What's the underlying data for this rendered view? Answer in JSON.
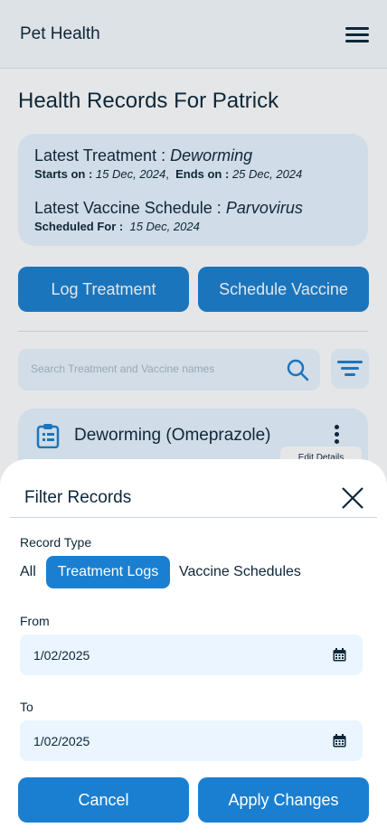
{
  "app": {
    "title": "Pet Health"
  },
  "page": {
    "title": "Health Records For Patrick"
  },
  "summary": {
    "treatment_label": "Latest Treatment : ",
    "treatment_name": "Deworming",
    "starts_label": "Starts on : ",
    "starts_date": "15 Dec, 2024",
    "ends_label": "Ends on : ",
    "ends_date": "25 Dec, 2024",
    "vaccine_label": "Latest Vaccine Schedule : ",
    "vaccine_name": "Parvovirus",
    "scheduled_label": "Scheduled For : ",
    "scheduled_date": "15 Dec, 2024"
  },
  "actions": {
    "log_treatment": "Log Treatment",
    "schedule_vaccine": "Schedule Vaccine"
  },
  "search": {
    "placeholder": "Search Treatment and Vaccine names"
  },
  "record": {
    "title": "Deworming (Omeprazole)",
    "edit_label": "Edit Details"
  },
  "filter": {
    "title": "Filter Records",
    "record_type_label": "Record Type",
    "options": [
      "All",
      "Treatment Logs",
      "Vaccine Schedules"
    ],
    "selected": "Treatment Logs",
    "from_label": "From",
    "from_value": "1/02/2025",
    "to_label": "To",
    "to_value": "1/02/2025",
    "cancel_label": "Cancel",
    "apply_label": "Apply Changes"
  },
  "colors": {
    "accent": "#1a7fd0",
    "card_bg": "#e8f4ff",
    "text": "#0c2638"
  }
}
